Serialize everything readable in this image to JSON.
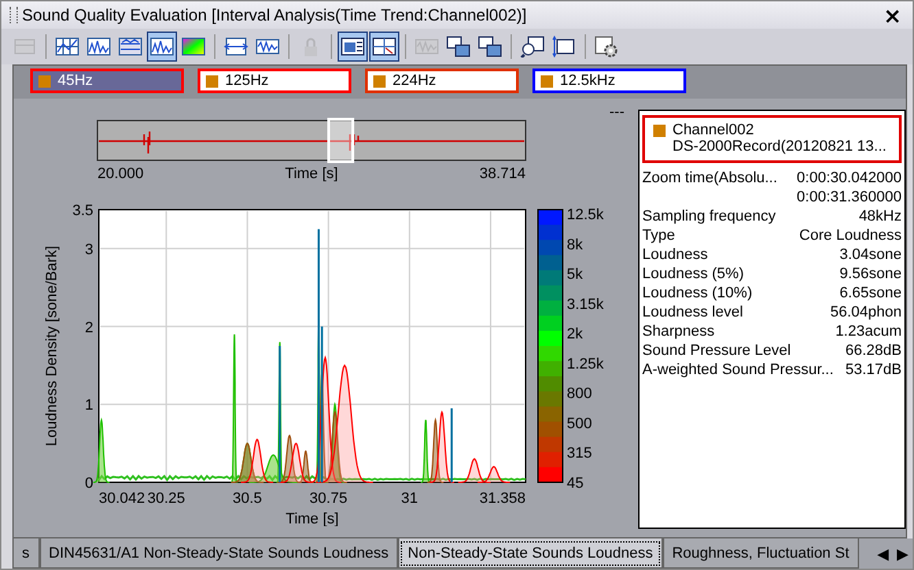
{
  "window": {
    "title": "Sound Quality Evaluation [Interval Analysis(Time Trend:Channel002)]",
    "close": "×"
  },
  "toolbar": [
    {
      "kind": "table",
      "disabled": true,
      "pressed": false
    },
    {
      "kind": "sep"
    },
    {
      "kind": "grid",
      "disabled": false,
      "pressed": false
    },
    {
      "kind": "wave",
      "disabled": false,
      "pressed": false
    },
    {
      "kind": "bars",
      "disabled": false,
      "pressed": false
    },
    {
      "kind": "wave",
      "disabled": false,
      "pressed": true
    },
    {
      "kind": "colormap",
      "disabled": false,
      "pressed": false
    },
    {
      "kind": "sep"
    },
    {
      "kind": "zoom",
      "disabled": false,
      "pressed": false
    },
    {
      "kind": "signal",
      "disabled": false,
      "pressed": false
    },
    {
      "kind": "sep"
    },
    {
      "kind": "lock",
      "disabled": true,
      "pressed": false
    },
    {
      "kind": "sep"
    },
    {
      "kind": "panel",
      "disabled": false,
      "pressed": true
    },
    {
      "kind": "cursor",
      "disabled": false,
      "pressed": true
    },
    {
      "kind": "sep"
    },
    {
      "kind": "signal",
      "disabled": true,
      "pressed": false
    },
    {
      "kind": "stack",
      "disabled": false,
      "pressed": false
    },
    {
      "kind": "stack",
      "disabled": false,
      "pressed": false
    },
    {
      "kind": "sep"
    },
    {
      "kind": "magnify",
      "disabled": false,
      "pressed": false
    },
    {
      "kind": "resize",
      "disabled": false,
      "pressed": false
    },
    {
      "kind": "sep"
    },
    {
      "kind": "gear",
      "disabled": false,
      "pressed": false
    }
  ],
  "bands": [
    {
      "label": "45Hz",
      "color": "#ff0000",
      "selected": true
    },
    {
      "label": "125Hz",
      "color": "#ff0000",
      "selected": false
    },
    {
      "label": "224Hz",
      "color": "#e03000",
      "selected": false
    },
    {
      "label": "12.5kHz",
      "color": "#0000ff",
      "selected": false
    }
  ],
  "overview": {
    "start": "20.000",
    "end": "38.714",
    "xlabel": "Time [s]",
    "value": "---"
  },
  "plot": {
    "ylabel": "Loudness Density [sone/Bark]",
    "xlabel": "Time [s]",
    "yticks": [
      "3.5",
      "3",
      "2",
      "1",
      "0"
    ],
    "xticks": [
      "30.042",
      "30.25",
      "30.5",
      "30.75",
      "31",
      "31.358"
    ],
    "colorbar": [
      "12.5k",
      "8k",
      "5k",
      "3.15k",
      "2k",
      "1.25k",
      "800",
      "500",
      "315",
      "45"
    ]
  },
  "info": {
    "channel": "Channel002",
    "source": "DS-2000Record(20120821 13...",
    "rows": [
      {
        "label": "Zoom time(Absolu...",
        "value": "0:00:30.042000"
      },
      {
        "value": "0:00:31.360000"
      },
      {
        "label": "Sampling frequency",
        "value": "48kHz"
      },
      {
        "label": "Type",
        "value": "Core Loudness"
      },
      {
        "label": "Loudness",
        "value": "3.04sone"
      },
      {
        "label": "Loudness (5%)",
        "value": "9.56sone"
      },
      {
        "label": "Loudness (10%)",
        "value": "6.65sone"
      },
      {
        "label": "Loudness level",
        "value": "56.04phon"
      },
      {
        "label": "Sharpness",
        "value": "1.23acum"
      },
      {
        "label": "Sound Pressure Level",
        "value": "66.28dB"
      },
      {
        "label": "A-weighted Sound Pressur...",
        "value": "53.17dB"
      }
    ]
  },
  "tabs": [
    {
      "label": "s",
      "selected": false
    },
    {
      "label": "DIN45631/A1 Non-Steady-State Sounds Loudness",
      "selected": false
    },
    {
      "label": "Non-Steady-State Sounds Loudness",
      "selected": true
    },
    {
      "label": "Roughness, Fluctuation St",
      "selected": false
    }
  ],
  "tab_scroll": [
    "◀",
    "▶"
  ]
}
